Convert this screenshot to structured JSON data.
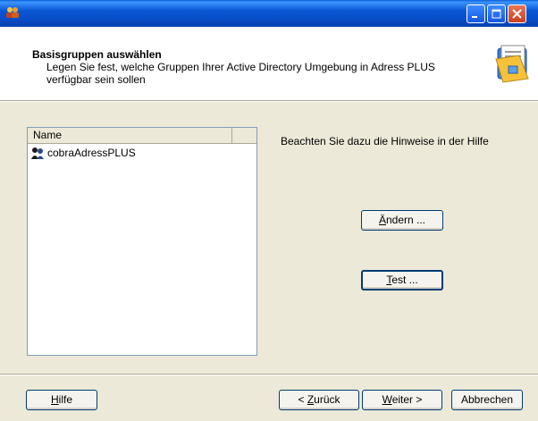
{
  "window": {
    "controls": {
      "minimize": "minimize-icon",
      "maximize": "maximize-icon",
      "close": "close-icon"
    }
  },
  "header": {
    "title": "Basisgruppen auswählen",
    "subtitle": "Legen Sie fest, welche Gruppen Ihrer Active Directory Umgebung in Adress PLUS verfügbar sein sollen"
  },
  "list": {
    "column_name": "Name",
    "items": [
      {
        "label": "cobraAdressPLUS",
        "icon": "group-icon"
      }
    ]
  },
  "hint": "Beachten Sie dazu die Hinweise in der Hilfe",
  "buttons": {
    "aendern_mnemonic": "Ä",
    "aendern_rest": "ndern ...",
    "test_mnemonic": "T",
    "test_rest": "est ...",
    "hilfe_mnemonic": "H",
    "hilfe_rest": "ilfe",
    "zurueck_prefix": "< ",
    "zurueck_mnemonic": "Z",
    "zurueck_rest": "urück",
    "weiter_mnemonic": "W",
    "weiter_rest": "eiter >",
    "abbrechen": "Abbrechen"
  },
  "colors": {
    "titlebar": "#0a56d4",
    "dialog_bg": "#ece9d8",
    "header_bg": "#ffffff",
    "list_border": "#7f9db9"
  }
}
